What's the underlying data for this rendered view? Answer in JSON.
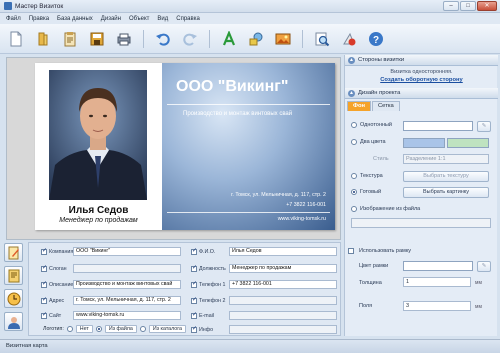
{
  "window": {
    "title": "Мастер Визиток"
  },
  "menu": [
    "Файл",
    "Правка",
    "База данных",
    "Дизайн",
    "Объект",
    "Вид",
    "Справка"
  ],
  "card": {
    "company": "ООО \"Викинг\"",
    "description": "Производство и монтаж винтовых свай",
    "address": "г. Томск, ул. Мельничная, д. 117, стр. 2",
    "phone": "+7 3822 116-001",
    "site": "www.viking-tomsk.ru",
    "person_name": "Илья Седов",
    "person_position": "Менеджер по продажам"
  },
  "fields": {
    "company_label": "Компания",
    "company_value": "ООО \"Викинг\"",
    "slogan_label": "Слоган",
    "slogan_value": "",
    "desc_label": "Описание",
    "desc_value": "Производство и монтаж винтовых свай",
    "address_label": "Адрес",
    "address_value": "г. Томск, ул. Мельничная, д. 117, стр. 2",
    "site_label": "Сайт",
    "site_value": "www.viking-tomsk.ru",
    "fio_label": "Ф.И.О.",
    "fio_value": "Илья Седов",
    "position_label": "Должность",
    "position_value": "Менеджер по продажам",
    "phone1_label": "Телефон 1",
    "phone1_value": "+7 3822 116-001",
    "phone2_label": "Телефон 2",
    "phone2_value": "",
    "email_label": "E-mail",
    "email_value": "",
    "info_label": "Инфо",
    "info_value": "",
    "logo_label": "Логотип:",
    "logo_none": "Нет",
    "logo_file": "Из файла",
    "logo_catalog": "Из каталога"
  },
  "panel": {
    "sides_title": "Стороны визитки",
    "one_sided_note": "Визитка односторонняя.",
    "create_back_link": "Создать оборотную сторону",
    "design_title": "Дизайн проекта",
    "tab_background": "Фон",
    "tab_grid": "Сетка",
    "opt_solid": "Однотонный",
    "opt_two_colors": "Два цвета",
    "style_label": "Стиль",
    "style_value": "Разделение 1:1",
    "opt_texture": "Текстура",
    "choose_texture": "Выбрать текстуру",
    "opt_ready": "Готовый",
    "choose_picture": "Выбрать картинку",
    "opt_image_file": "Изображение из файла",
    "use_frame": "Использовать рамку",
    "frame_color": "Цвет рамки",
    "thickness_label": "Толщина",
    "thickness_value": "1",
    "thickness_unit": "мм",
    "margins_label": "Поля",
    "margins_value": "3",
    "margins_unit": "мм",
    "swatch_light": "#a9c4e8",
    "swatch_green": "#bfe3c0"
  },
  "status": {
    "text": "Визитная карта"
  }
}
